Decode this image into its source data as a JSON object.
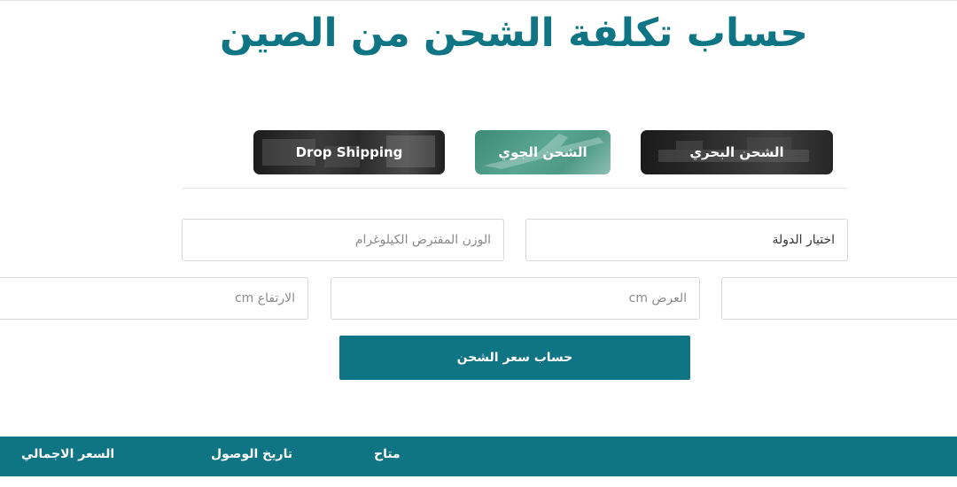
{
  "page": {
    "title": "حساب تكلفة الشحن من الصين"
  },
  "tabs": {
    "drop_shipping": "Drop Shipping",
    "air_freight": "الشحن الجوي",
    "sea_freight": "الشحن البحري"
  },
  "form": {
    "country_select": {
      "value": "اختيار الدولة"
    },
    "weight": {
      "placeholder": "الوزن المفترض الكيلوغرام"
    },
    "length": {
      "placeholder": ""
    },
    "width": {
      "placeholder": "العرض cm"
    },
    "height": {
      "placeholder": "الارتفاع cm"
    },
    "submit_label": "حساب سعر الشحن"
  },
  "results": {
    "columns": {
      "available": "متاح",
      "arrival_date": "تاريخ الوصول",
      "total_price": "السعر الاجمالي"
    }
  },
  "colors": {
    "accent": "#0f7483",
    "air_tab": "#4e9a86",
    "dark_tab": "#2a2a2a"
  }
}
